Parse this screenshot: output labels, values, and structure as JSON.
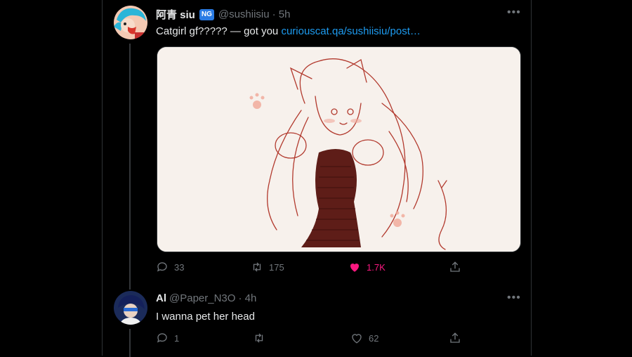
{
  "tweets": [
    {
      "display_name": "阿青 siu",
      "badge": "NG",
      "handle": "@sushiisiu",
      "time": "· 5h",
      "text": "Catgirl gf????? — got you ",
      "link": "curiouscat.qa/sushiisiu/post…",
      "more": "•••",
      "replies": "33",
      "retweets": "175",
      "likes": "1.7K",
      "liked": true
    },
    {
      "display_name": "Al",
      "handle": "@Paper_N3O",
      "time": "· 4h",
      "text": "I wanna pet her head",
      "more": "•••",
      "replies": "1",
      "retweets": "",
      "likes": "62",
      "liked": false
    }
  ],
  "colors": {
    "background": "#000000",
    "accent": "#1d9bf0",
    "like": "#f91880",
    "muted": "#71767b"
  }
}
